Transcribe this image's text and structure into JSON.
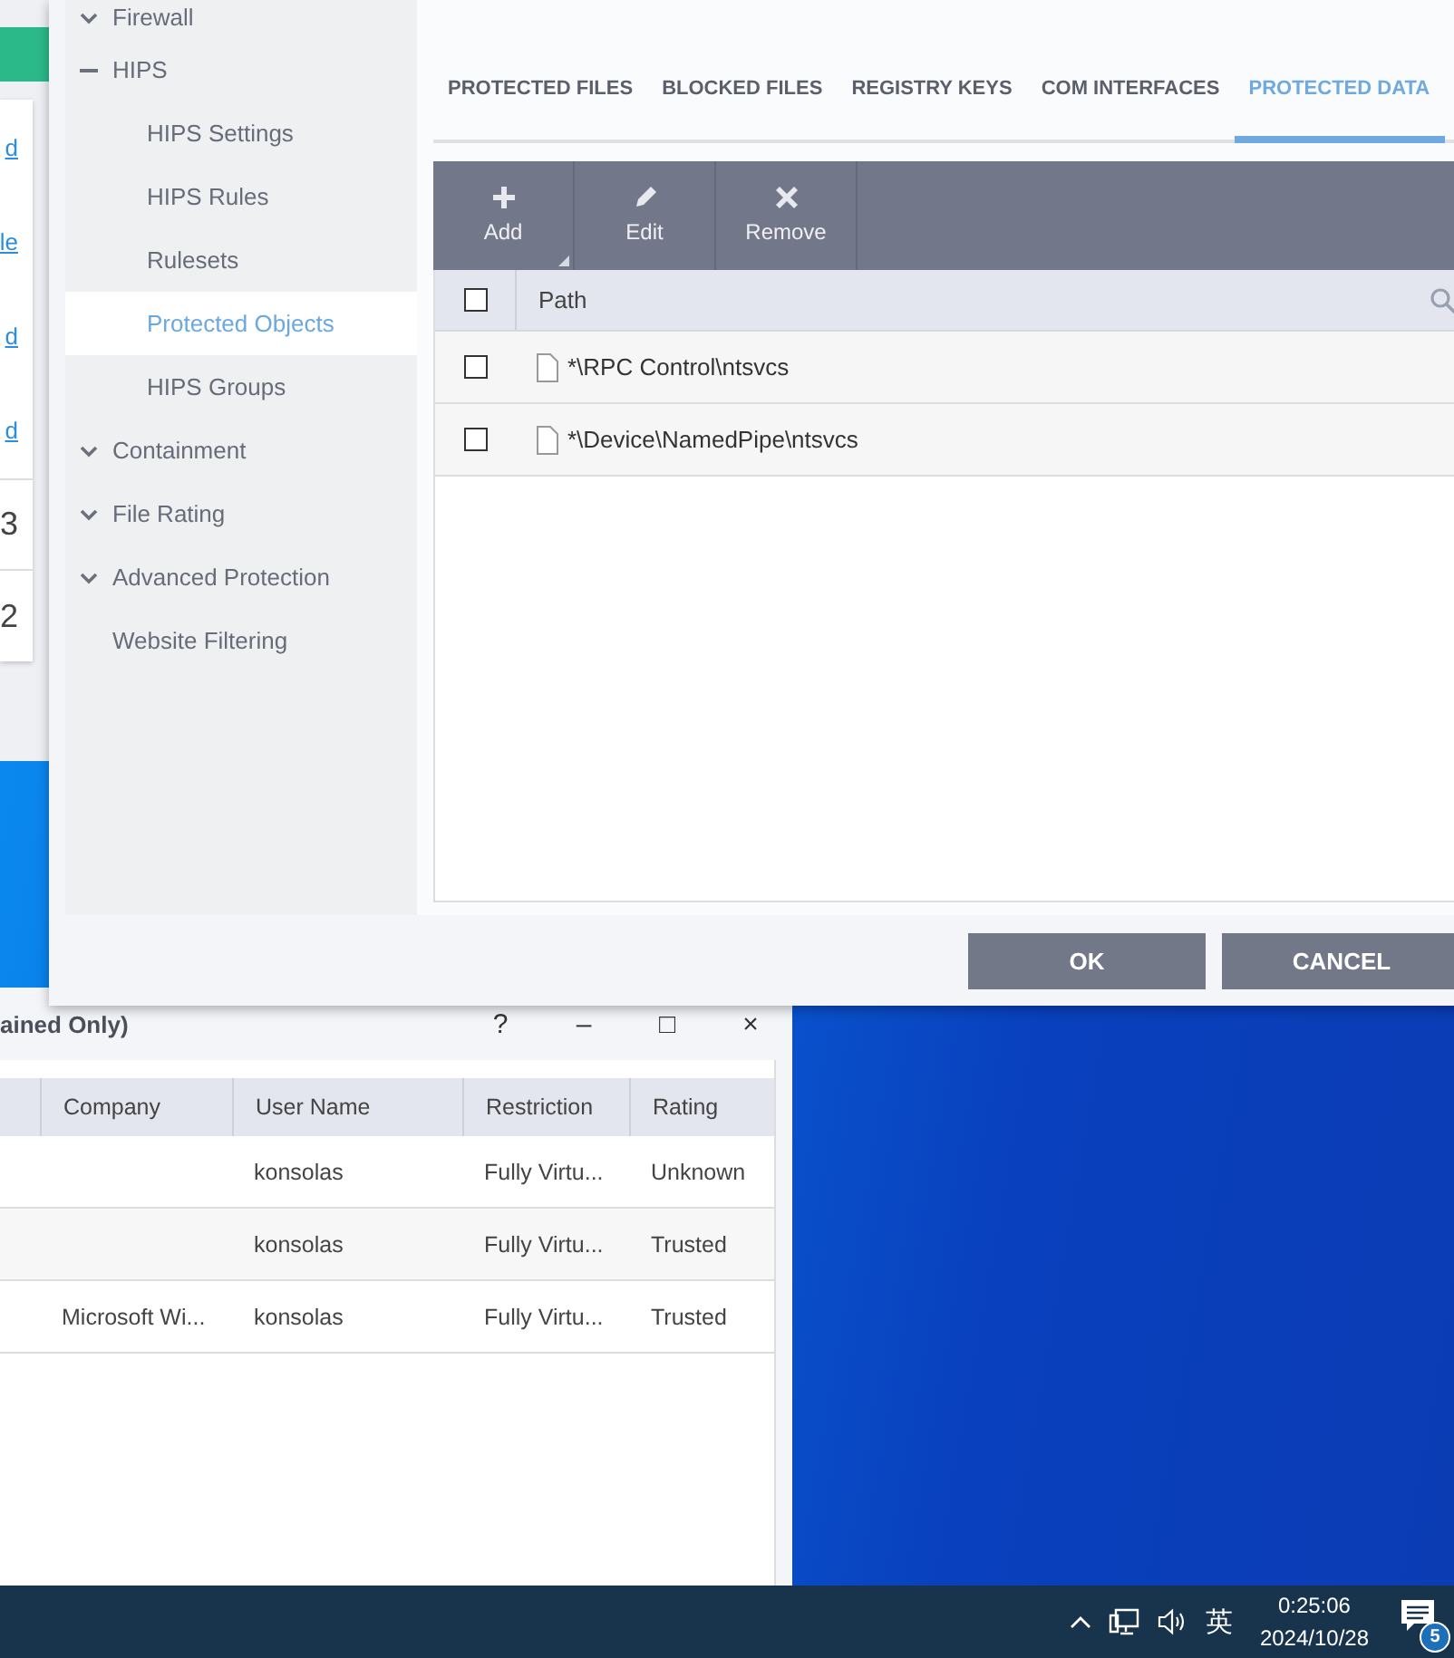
{
  "background_window": {
    "links": [
      "d",
      "le",
      "d",
      "d"
    ],
    "counts": [
      "3",
      "2"
    ]
  },
  "dialog": {
    "sidebar": [
      {
        "label": "Firewall",
        "kind": "group",
        "expanded": false
      },
      {
        "label": "HIPS",
        "kind": "group",
        "expanded": true,
        "children": [
          {
            "label": "HIPS Settings",
            "selected": false
          },
          {
            "label": "HIPS Rules",
            "selected": false
          },
          {
            "label": "Rulesets",
            "selected": false
          },
          {
            "label": "Protected Objects",
            "selected": true
          },
          {
            "label": "HIPS Groups",
            "selected": false
          }
        ]
      },
      {
        "label": "Containment",
        "kind": "group",
        "expanded": false
      },
      {
        "label": "File Rating",
        "kind": "group",
        "expanded": false
      },
      {
        "label": "Advanced Protection",
        "kind": "group",
        "expanded": false
      },
      {
        "label": "Website Filtering",
        "kind": "link"
      }
    ],
    "tabs": [
      {
        "label": "PROTECTED FILES",
        "selected": false
      },
      {
        "label": "BLOCKED FILES",
        "selected": false
      },
      {
        "label": "REGISTRY KEYS",
        "selected": false
      },
      {
        "label": "COM INTERFACES",
        "selected": false
      },
      {
        "label": "PROTECTED DATA",
        "selected": true
      }
    ],
    "toolbar": [
      {
        "label": "Add",
        "kind": "add",
        "menu": true
      },
      {
        "label": "Edit",
        "kind": "edit",
        "menu": false
      },
      {
        "label": "Remove",
        "kind": "remove",
        "menu": false
      }
    ],
    "table": {
      "header_checked": false,
      "columns": [
        "Path"
      ],
      "rows": [
        {
          "path": "*\\RPC Control\\ntsvcs",
          "checked": false
        },
        {
          "path": "*\\Device\\NamedPipe\\ntsvcs",
          "checked": false
        }
      ]
    },
    "buttons": [
      "OK",
      "CANCEL"
    ]
  },
  "sandbox_window": {
    "title": "ained Only)",
    "controls": [
      "?",
      "–",
      "□",
      "×"
    ],
    "columns": [
      "Company",
      "User Name",
      "Restriction",
      "Rating"
    ],
    "rows": [
      {
        "user_name": "konsolas",
        "restriction": "Fully Virtu...",
        "rating": "Unknown"
      },
      {
        "user_name": "konsolas",
        "restriction": "Fully Virtu...",
        "rating": "Trusted"
      },
      {
        "company": "Microsoft Wi...",
        "user_name": "konsolas",
        "restriction": "Fully Virtu...",
        "rating": "Trusted"
      }
    ]
  },
  "taskbar": {
    "ime": "英",
    "time": "0:25:06",
    "date": "2024/10/28",
    "notifications": "5"
  }
}
